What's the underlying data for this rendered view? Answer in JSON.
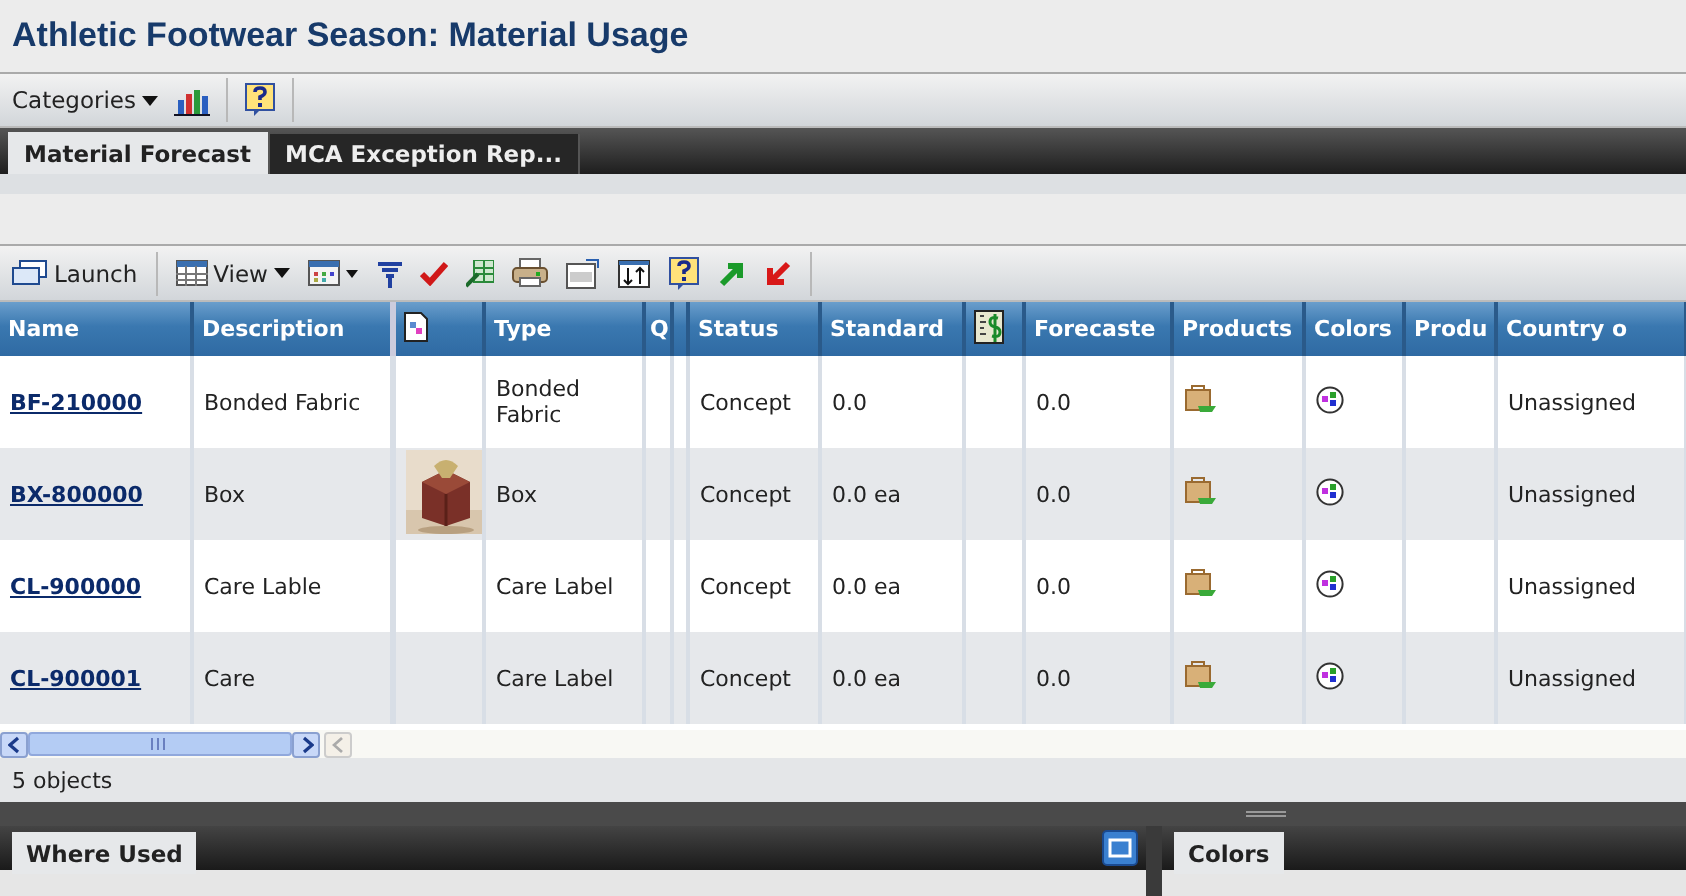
{
  "title": "Athletic Footwear Season: Material Usage",
  "menu": {
    "label": "Categories"
  },
  "tabs": [
    {
      "label": "Material Forecast",
      "selected": true
    },
    {
      "label": "MCA Exception Rep...",
      "selected": false
    }
  ],
  "toolbar": {
    "launch": "Launch",
    "view": "View"
  },
  "table": {
    "columns": [
      {
        "label": "Name",
        "kind": "text"
      },
      {
        "label": "Description",
        "kind": "text"
      },
      {
        "kind": "icon"
      },
      {
        "label": "Type",
        "kind": "text"
      },
      {
        "label": "Q",
        "kind": "text"
      },
      {
        "kind": "narrow"
      },
      {
        "label": "Status",
        "kind": "text"
      },
      {
        "label": "Standard",
        "kind": "text"
      },
      {
        "kind": "money"
      },
      {
        "label": "Forecaste",
        "kind": "text"
      },
      {
        "label": "Products",
        "kind": "text"
      },
      {
        "label": "Colors",
        "kind": "text"
      },
      {
        "label": "Produ",
        "kind": "text"
      },
      {
        "label": "Country o",
        "kind": "text"
      }
    ],
    "rows": [
      {
        "name": "BF-210000",
        "description": "Bonded Fabric",
        "type": "Bonded Fabric",
        "status": "Concept",
        "standard": "0.0",
        "forecast": "0.0",
        "country": "Unassigned"
      },
      {
        "name": "BX-800000",
        "description": "Box",
        "type": "Box",
        "status": "Concept",
        "standard": "0.0 ea",
        "forecast": "0.0",
        "country": "Unassigned"
      },
      {
        "name": "CL-900000",
        "description": "Care Lable",
        "type": "Care Label",
        "status": "Concept",
        "standard": "0.0 ea",
        "forecast": "0.0",
        "country": "Unassigned"
      },
      {
        "name": "CL-900001",
        "description": "Care",
        "type": "Care Label",
        "status": "Concept",
        "standard": "0.0 ea",
        "forecast": "0.0",
        "country": "Unassigned"
      }
    ]
  },
  "status_bar": "5 objects",
  "bottom_tabs": [
    {
      "label": "Where Used",
      "selected": true
    },
    {
      "label": "Colors",
      "selected": true
    }
  ]
}
